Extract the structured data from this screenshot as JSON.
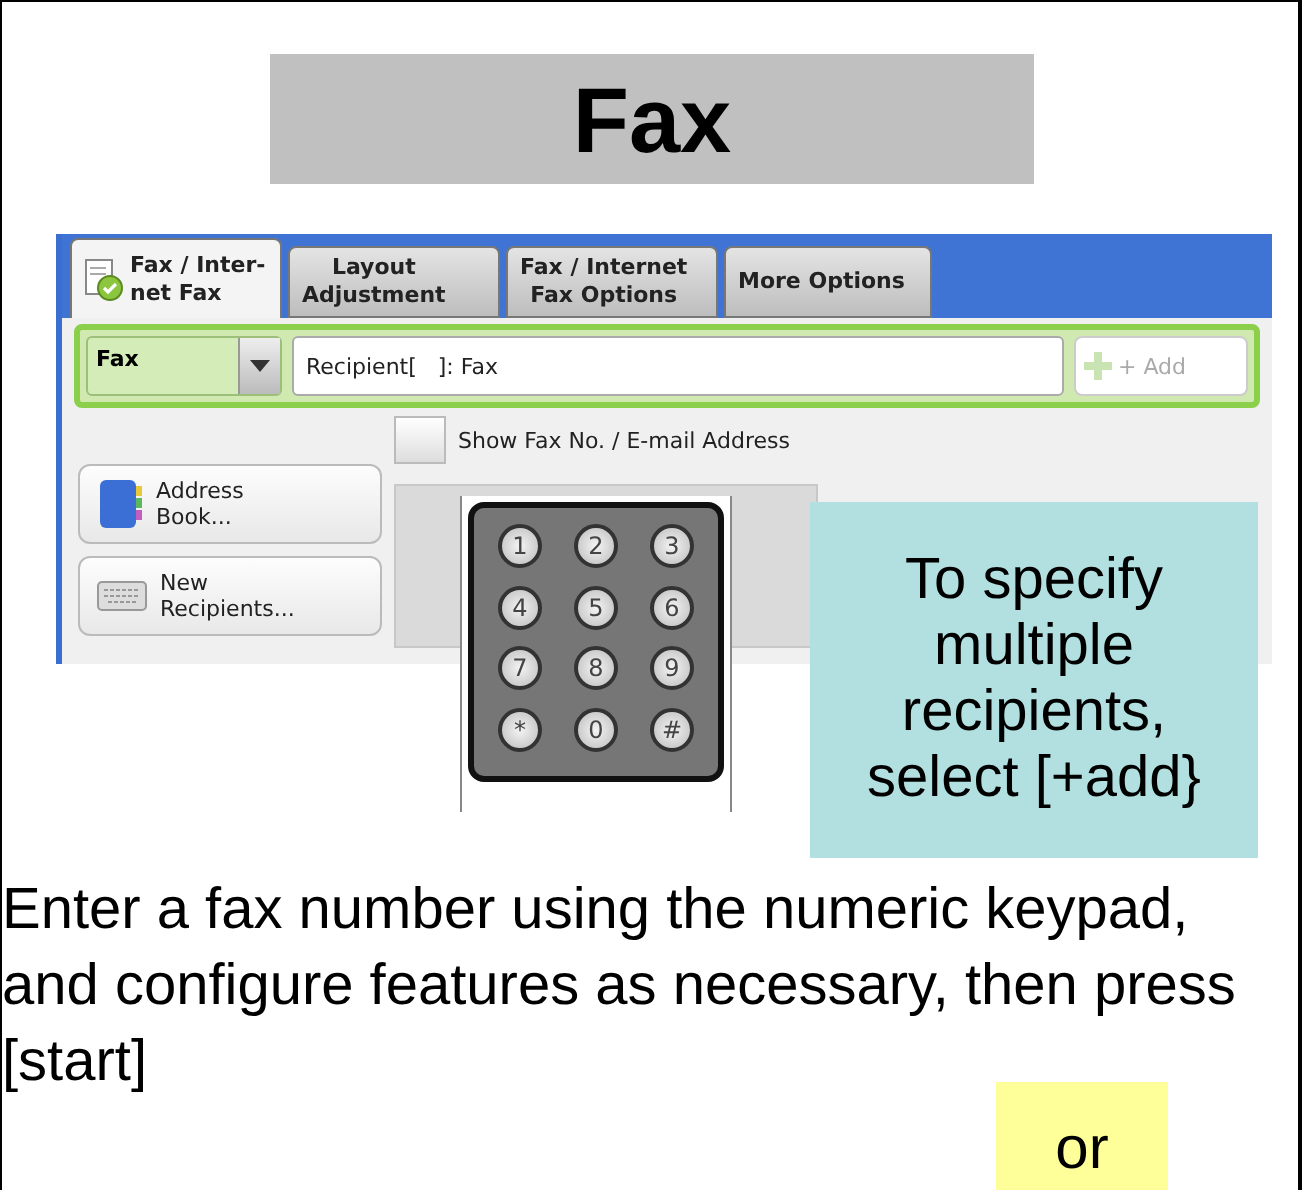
{
  "title": "Fax",
  "screenshot": {
    "tabs": [
      {
        "label": "Fax / Inter-\nnet Fax",
        "selected": true
      },
      {
        "label": "Layout\nAdjustment",
        "selected": false
      },
      {
        "label": "Fax / Internet\nFax Options",
        "selected": false
      },
      {
        "label": "More Options",
        "selected": false
      }
    ],
    "mode": "Fax",
    "recipient_field": {
      "value": "Recipient[   ]: Fax"
    },
    "add_button": "+ Add",
    "show_address": {
      "label": "Show Fax No. / E-mail Address",
      "checked": false
    },
    "side_buttons": [
      {
        "label": "Address\nBook...",
        "kind": "book"
      },
      {
        "label": "New\nRecipients...",
        "kind": "keyboard"
      }
    ],
    "keypad": [
      "1",
      "2",
      "3",
      "4",
      "5",
      "6",
      "7",
      "8",
      "9",
      "*",
      "0",
      "#"
    ]
  },
  "callout": "To specify multiple recipients, select [+add}",
  "instruction": "Enter a fax number using the  numeric keypad, and configure features as necessary, then press [start]",
  "highlight": "or"
}
